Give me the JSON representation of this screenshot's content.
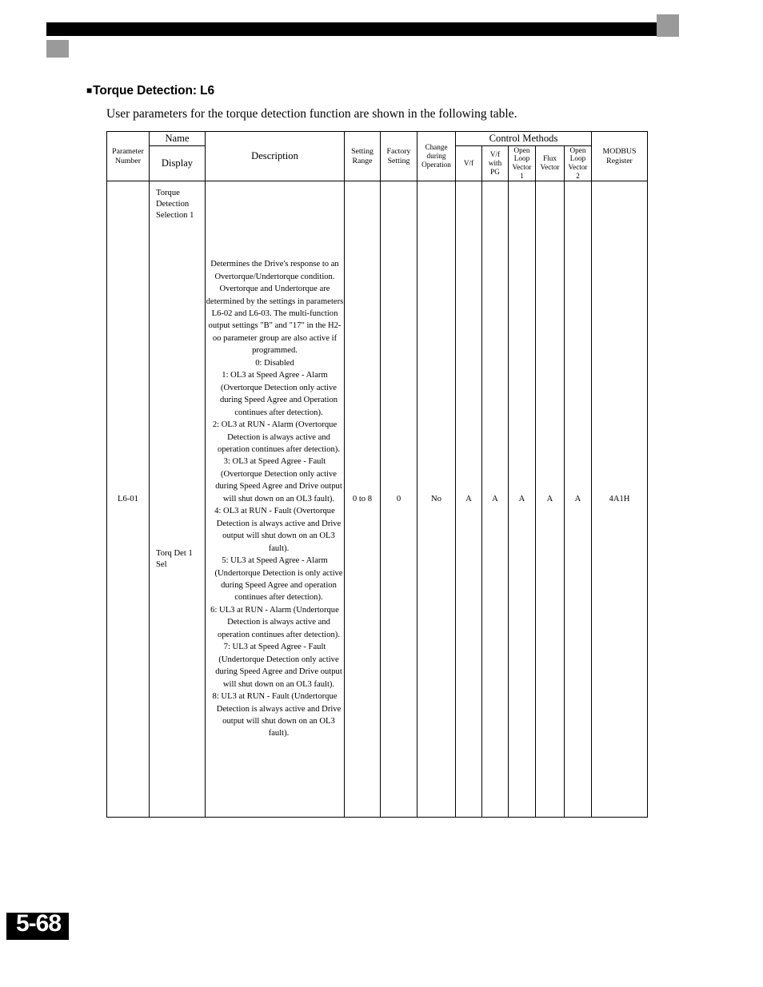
{
  "heading": {
    "bullet": "■",
    "title": "Torque Detection: L6"
  },
  "intro": "User parameters for the torque detection function are shown in the following table.",
  "table": {
    "headers": {
      "parameter_number": "Parameter\nNumber",
      "name": "Name",
      "display": "Display",
      "description": "Description",
      "setting_range": "Setting\nRange",
      "factory_setting": "Factory\nSetting",
      "change_during_operation": "Change\nduring\nOperation",
      "control_methods": "Control Methods",
      "vf": "V/f",
      "vf_with_pg": "V/f\nwith\nPG",
      "open_loop_vector_1": "Open\nLoop\nVector\n1",
      "flux_vector": "Flux\nVector",
      "open_loop_vector_2": "Open\nLoop\nVector\n2",
      "modbus_register": "MODBUS\nRegister"
    },
    "row": {
      "parameter_number": "L6-01",
      "name": "Torque\nDetection\nSelection 1",
      "display": "Torq Det 1\nSel",
      "description_intro": "Determines the Drive's response to an Overtorque/Undertorque condition. Overtorque and Undertorque are determined by the settings in parameters L6-02 and L6-03. The multi-function output settings \"B\" and \"17\" in the H2-oo parameter group are also active if programmed.",
      "options": [
        "0: Disabled",
        "1: OL3 at Speed Agree - Alarm (Overtorque Detection only active during Speed Agree and Operation continues after detection).",
        "2: OL3 at RUN - Alarm (Overtorque Detection is always active and operation continues after detection).",
        "3: OL3 at Speed Agree - Fault (Overtorque Detection only active during Speed Agree and Drive output will shut down on an OL3 fault).",
        "4: OL3 at RUN - Fault (Overtorque Detection is always active and Drive output will shut down on an OL3 fault).",
        "5: UL3 at Speed Agree - Alarm (Undertorque Detection is only active during Speed Agree and operation continues after detection).",
        "6: UL3 at RUN - Alarm (Undertorque Detection is always active and operation continues after detection).",
        "7: UL3 at Speed Agree - Fault (Undertorque Detection only active during Speed Agree and Drive output will shut down on an OL3 fault).",
        "8: UL3 at RUN - Fault (Undertorque Detection is always active and Drive output will shut down on an OL3 fault)."
      ],
      "setting_range": "0 to 8",
      "factory_setting": "0",
      "change_during_operation": "No",
      "vf": "A",
      "vf_with_pg": "A",
      "open_loop_vector_1": "A",
      "flux_vector": "A",
      "open_loop_vector_2": "A",
      "modbus_register": "4A1H"
    }
  },
  "footer": {
    "page": "5-68"
  }
}
